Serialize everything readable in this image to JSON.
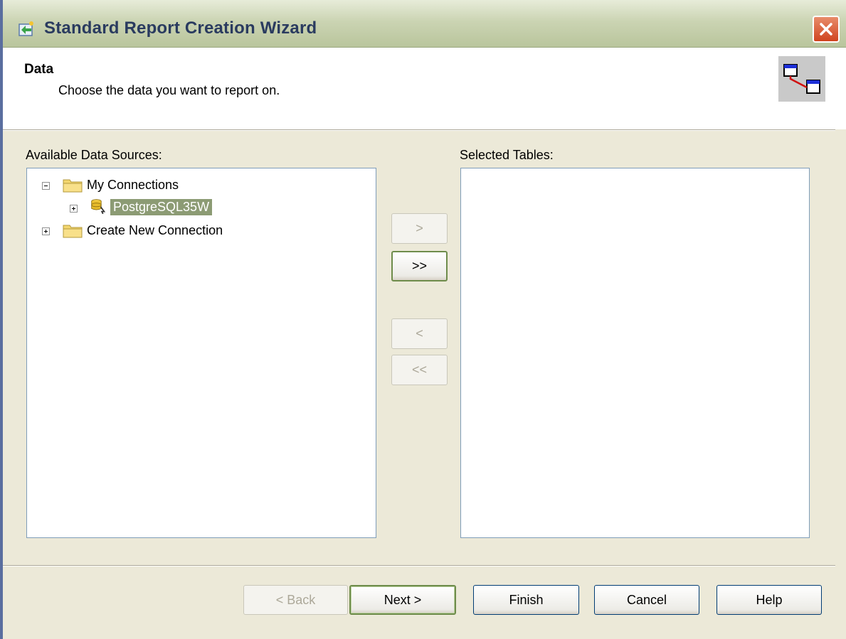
{
  "window": {
    "title": "Standard Report Creation Wizard"
  },
  "header": {
    "title": "Data",
    "subtitle": "Choose the data you want to report on."
  },
  "available": {
    "label": "Available Data Sources:",
    "tree": [
      {
        "label": "My Connections",
        "expanded": true
      },
      {
        "label": "PostgreSQL35W",
        "selected": true
      },
      {
        "label": "Create New Connection",
        "expanded": false
      }
    ]
  },
  "selected": {
    "label": "Selected Tables:"
  },
  "move_buttons": {
    "add_one": ">",
    "add_all": ">>",
    "remove_one": "<",
    "remove_all": "<<"
  },
  "footer": {
    "back": "< Back",
    "next": "Next >",
    "finish": "Finish",
    "cancel": "Cancel",
    "help": "Help"
  },
  "colors": {
    "selection": "#8c9b74",
    "title_text": "#2a3b5f",
    "close_button": "#d0441f"
  },
  "icons": {
    "app": "wizard-icon",
    "header": "table-link-icon",
    "folder": "folder-icon",
    "database": "database-icon"
  }
}
